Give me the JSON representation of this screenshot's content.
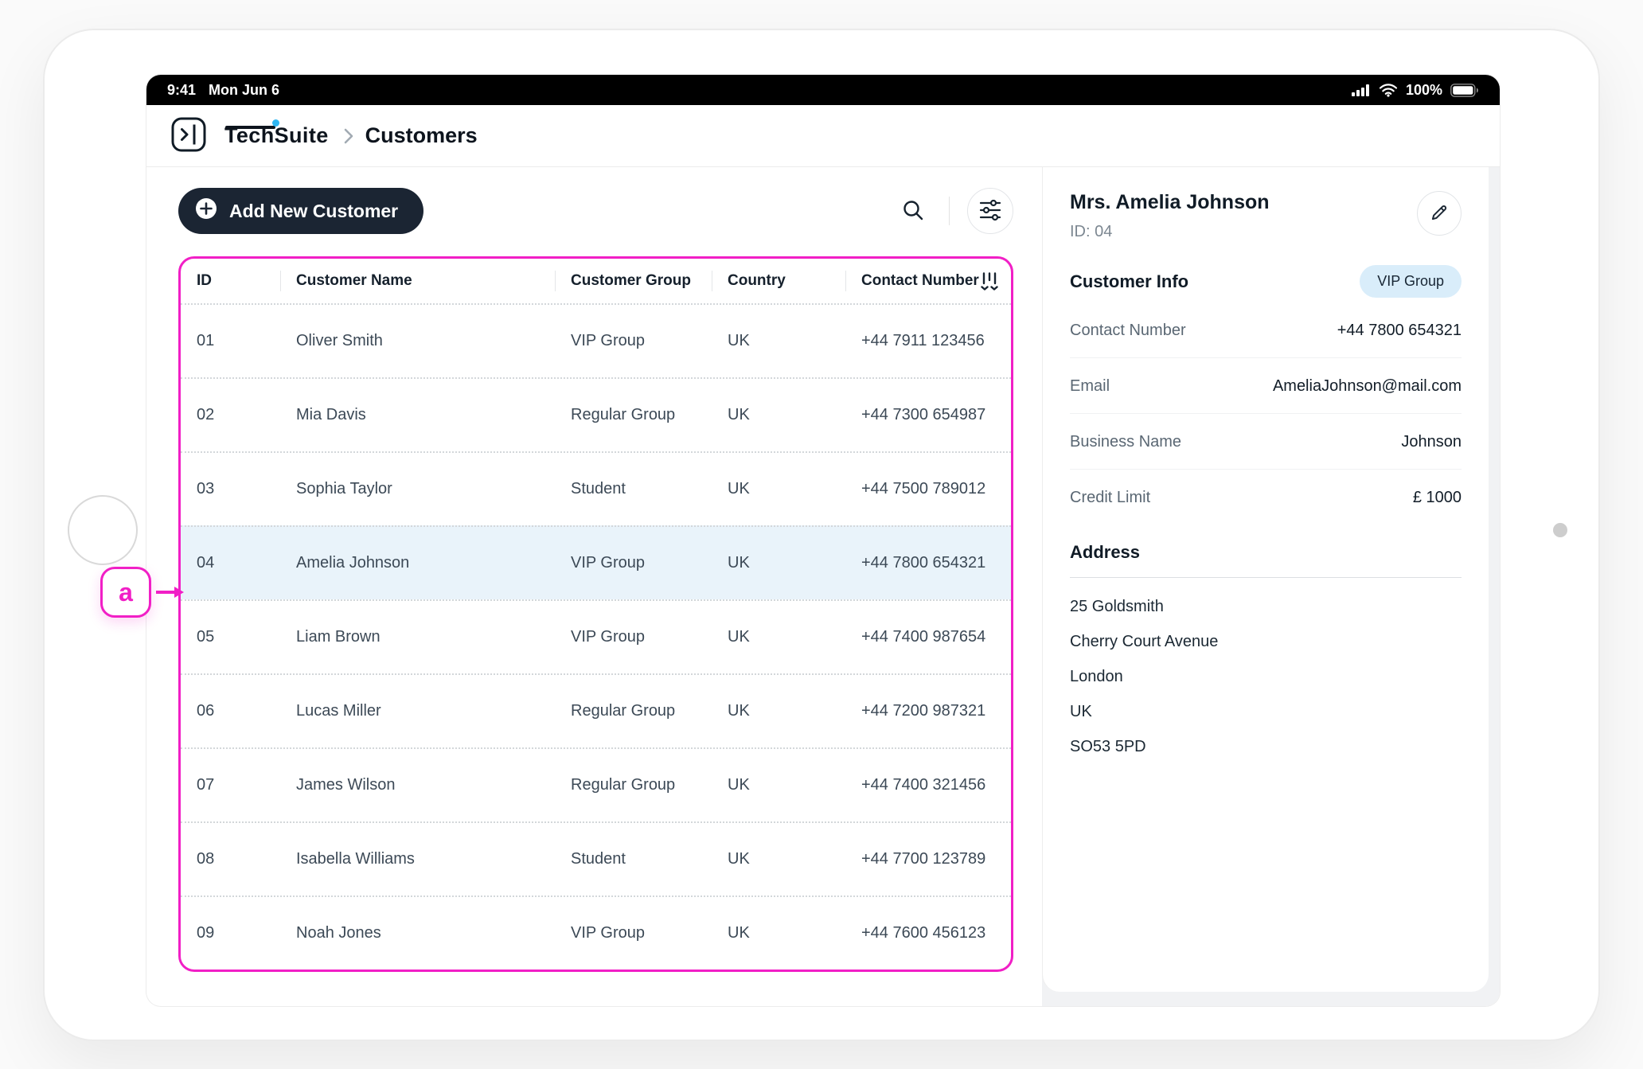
{
  "status_bar": {
    "time": "9:41",
    "date": "Mon Jun 6",
    "battery": "100%"
  },
  "header": {
    "logo_tech": "Tech",
    "logo_suite": "Suite",
    "breadcrumb_current": "Customers"
  },
  "toolbar": {
    "add_label": "Add New Customer"
  },
  "table": {
    "columns": [
      "ID",
      "Customer Name",
      "Customer Group",
      "Country",
      "Contact Number"
    ],
    "rows": [
      {
        "id": "01",
        "name": "Oliver Smith",
        "group": "VIP Group",
        "country": "UK",
        "phone": "+44 7911 123456"
      },
      {
        "id": "02",
        "name": "Mia Davis",
        "group": "Regular Group",
        "country": "UK",
        "phone": "+44 7300 654987"
      },
      {
        "id": "03",
        "name": "Sophia Taylor",
        "group": "Student",
        "country": "UK",
        "phone": "+44 7500 789012"
      },
      {
        "id": "04",
        "name": "Amelia Johnson",
        "group": "VIP Group",
        "country": "UK",
        "phone": "+44 7800 654321"
      },
      {
        "id": "05",
        "name": "Liam Brown",
        "group": "VIP Group",
        "country": "UK",
        "phone": "+44 7400 987654"
      },
      {
        "id": "06",
        "name": "Lucas Miller",
        "group": "Regular Group",
        "country": "UK",
        "phone": "+44 7200 987321"
      },
      {
        "id": "07",
        "name": "James Wilson",
        "group": "Regular Group",
        "country": "UK",
        "phone": "+44 7400 321456"
      },
      {
        "id": "08",
        "name": "Isabella Williams",
        "group": "Student",
        "country": "UK",
        "phone": "+44 7700 123789"
      },
      {
        "id": "09",
        "name": "Noah Jones",
        "group": "VIP Group",
        "country": "UK",
        "phone": "+44 7600 456123"
      }
    ],
    "selected_row_id": "04"
  },
  "detail": {
    "title": "Mrs. Amelia Johnson",
    "id_label": "ID: 04",
    "section_customer_info": "Customer Info",
    "badge": "VIP Group",
    "fields": [
      {
        "label": "Contact Number",
        "value": "+44 7800 654321"
      },
      {
        "label": "Email",
        "value": "AmeliaJohnson@mail.com"
      },
      {
        "label": "Business Name",
        "value": "Johnson"
      },
      {
        "label": "Credit Limit",
        "value": "£ 1000"
      }
    ],
    "section_address": "Address",
    "address_lines": [
      "25 Goldsmith",
      "Cherry Court Avenue",
      "London",
      "UK",
      "SO53 5PD"
    ]
  },
  "annotation": {
    "label": "a"
  },
  "colors": {
    "accent_magenta": "#F11FC6",
    "selected_row_bg": "#E9F3FA",
    "badge_bg": "#D9EDFA",
    "primary_button_bg": "#1B2533",
    "logo_accent_blue": "#2EB6F2",
    "status_bar_bg": "#000000"
  }
}
